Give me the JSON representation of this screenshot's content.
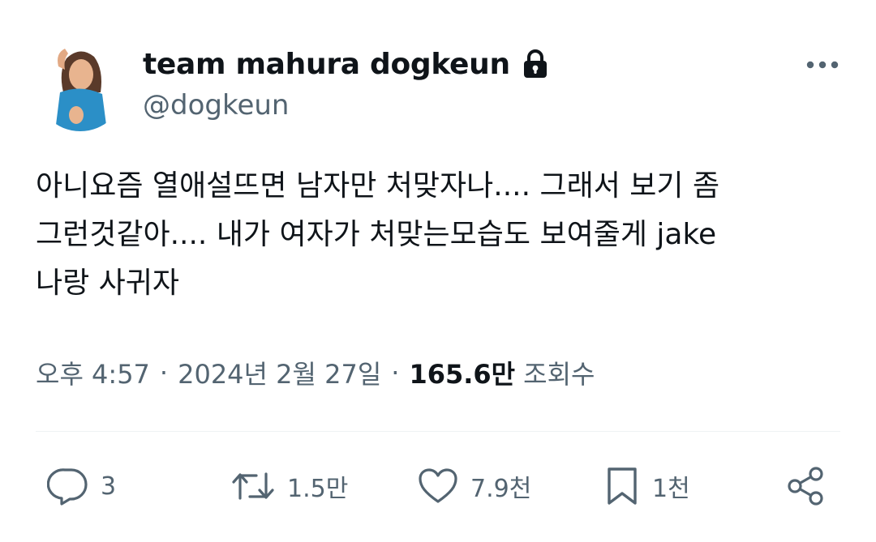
{
  "author": {
    "display_name": "team mahura dogkeun",
    "handle": "@dogkeun",
    "protected_icon": "lock-icon",
    "avatar_icon": "profile-photo"
  },
  "tweet": {
    "lines": [
      "아니요즘 열애설뜨면 남자만 처맞자나.... 그래서 보기 좀",
      "그런것같아.... 내가 여자가 처맞는모습도 보여줄게 jake",
      "나랑 사귀자"
    ],
    "time": "오후 4:57",
    "date": "2024년 2월 27일",
    "dot": "·",
    "views_count": "165.6만",
    "views_label": "조회수"
  },
  "actions": {
    "reply": {
      "icon": "reply-icon",
      "count": "3"
    },
    "retweet": {
      "icon": "retweet-icon",
      "count": "1.5만"
    },
    "like": {
      "icon": "heart-icon",
      "count": "7.9천"
    },
    "bookmark": {
      "icon": "bookmark-icon",
      "count": "1천"
    },
    "share": {
      "icon": "share-icon"
    }
  },
  "more_icon": "more-icon",
  "colors": {
    "text": "#0f1419",
    "secondary": "#536471",
    "divider": "#eff3f4"
  }
}
